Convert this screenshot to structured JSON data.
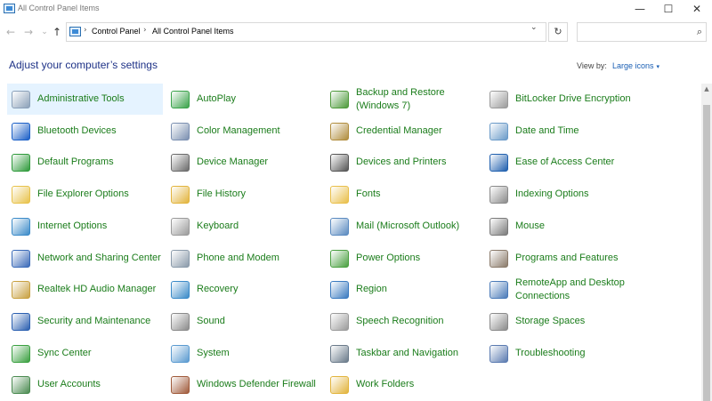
{
  "window": {
    "title": "All Control Panel Items",
    "minimize": "—",
    "maximize": "☐",
    "close": "✕"
  },
  "nav": {
    "back": "←",
    "forward": "→",
    "recent": "⌄",
    "up": "↑"
  },
  "address": {
    "separator": "›",
    "crumbs": [
      "Control Panel",
      "All Control Panel Items"
    ],
    "dropdown": "⌄",
    "refresh": "↻"
  },
  "search": {
    "placeholder": "",
    "icon": "⌕"
  },
  "header": {
    "title": "Adjust your computer’s settings",
    "view_by_label": "View by:",
    "view_by_value": "Large icons",
    "view_by_arrow": "▾"
  },
  "items": [
    {
      "label": "Administrative Tools",
      "icon": "admin-tools-icon",
      "color": "#8aa0b8"
    },
    {
      "label": "AutoPlay",
      "icon": "autoplay-icon",
      "color": "#3aa34a"
    },
    {
      "label": "Backup and Restore (Windows 7)",
      "icon": "backup-restore-icon",
      "color": "#4d9a3a"
    },
    {
      "label": "BitLocker Drive Encryption",
      "icon": "bitlocker-icon",
      "color": "#9a9a9a"
    },
    {
      "label": "Bluetooth Devices",
      "icon": "bluetooth-icon",
      "color": "#1a5fc7"
    },
    {
      "label": "Color Management",
      "icon": "color-management-icon",
      "color": "#7a8fb0"
    },
    {
      "label": "Credential Manager",
      "icon": "credential-manager-icon",
      "color": "#b08c3c"
    },
    {
      "label": "Date and Time",
      "icon": "date-time-icon",
      "color": "#6a9ac8"
    },
    {
      "label": "Default Programs",
      "icon": "default-programs-icon",
      "color": "#2e9a3a"
    },
    {
      "label": "Device Manager",
      "icon": "device-manager-icon",
      "color": "#6a6a6a"
    },
    {
      "label": "Devices and Printers",
      "icon": "devices-printers-icon",
      "color": "#555555"
    },
    {
      "label": "Ease of Access Center",
      "icon": "ease-of-access-icon",
      "color": "#1f5fae"
    },
    {
      "label": "File Explorer Options",
      "icon": "file-explorer-options-icon",
      "color": "#e8c24a"
    },
    {
      "label": "File History",
      "icon": "file-history-icon",
      "color": "#e2b43c"
    },
    {
      "label": "Fonts",
      "icon": "fonts-icon",
      "color": "#e9bf4a"
    },
    {
      "label": "Indexing Options",
      "icon": "indexing-options-icon",
      "color": "#8a8a8a"
    },
    {
      "label": "Internet Options",
      "icon": "internet-options-icon",
      "color": "#3a8ac8"
    },
    {
      "label": "Keyboard",
      "icon": "keyboard-icon",
      "color": "#9a9a9a"
    },
    {
      "label": "Mail (Microsoft Outlook)",
      "icon": "mail-icon",
      "color": "#5a8ac0"
    },
    {
      "label": "Mouse",
      "icon": "mouse-icon",
      "color": "#7a7a7a"
    },
    {
      "label": "Network and Sharing Center",
      "icon": "network-sharing-icon",
      "color": "#3a6ab8"
    },
    {
      "label": "Phone and Modem",
      "icon": "phone-modem-icon",
      "color": "#8a9aaa"
    },
    {
      "label": "Power Options",
      "icon": "power-options-icon",
      "color": "#4aa040"
    },
    {
      "label": "Programs and Features",
      "icon": "programs-features-icon",
      "color": "#8a7a6a"
    },
    {
      "label": "Realtek HD Audio Manager",
      "icon": "realtek-audio-icon",
      "color": "#c8a040"
    },
    {
      "label": "Recovery",
      "icon": "recovery-icon",
      "color": "#3a8ac8"
    },
    {
      "label": "Region",
      "icon": "region-icon",
      "color": "#3a7ac0"
    },
    {
      "label": "RemoteApp and Desktop Connections",
      "icon": "remoteapp-icon",
      "color": "#4a7ab8"
    },
    {
      "label": "Security and Maintenance",
      "icon": "security-maintenance-icon",
      "color": "#2a5fb0"
    },
    {
      "label": "Sound",
      "icon": "sound-icon",
      "color": "#8a8a8a"
    },
    {
      "label": "Speech Recognition",
      "icon": "speech-recognition-icon",
      "color": "#9a9a9a"
    },
    {
      "label": "Storage Spaces",
      "icon": "storage-spaces-icon",
      "color": "#8a8a8a"
    },
    {
      "label": "Sync Center",
      "icon": "sync-center-icon",
      "color": "#3aa040"
    },
    {
      "label": "System",
      "icon": "system-icon",
      "color": "#5a9ad0"
    },
    {
      "label": "Taskbar and Navigation",
      "icon": "taskbar-navigation-icon",
      "color": "#6a7a8a"
    },
    {
      "label": "Troubleshooting",
      "icon": "troubleshooting-icon",
      "color": "#5a7ab0"
    },
    {
      "label": "User Accounts",
      "icon": "user-accounts-icon",
      "color": "#4a8a50"
    },
    {
      "label": "Windows Defender Firewall",
      "icon": "firewall-icon",
      "color": "#a05a3a"
    },
    {
      "label": "Work Folders",
      "icon": "work-folders-icon",
      "color": "#e2b43c"
    }
  ],
  "scrollbar": {
    "up": "▲"
  }
}
